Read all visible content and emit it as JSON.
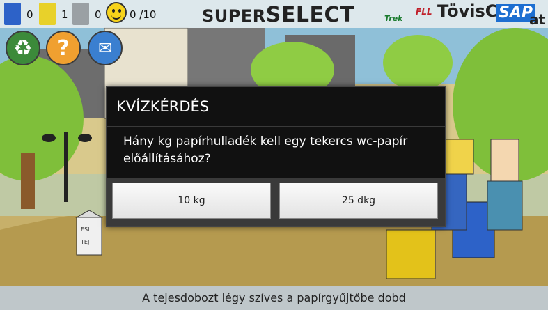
{
  "hud": {
    "bins": [
      {
        "color": "#2d62c8",
        "count": "0"
      },
      {
        "color": "#e8d12a",
        "count": "1"
      },
      {
        "color": "#9aa0a4",
        "count": "0"
      }
    ],
    "score": "0 /10",
    "brand": {
      "first": "SUPER",
      "second": "SELECT"
    },
    "sponsors": [
      "Trek",
      "FLL",
      "TövisC",
      "SAP",
      "at"
    ]
  },
  "side_buttons": [
    {
      "icon": "recycle-icon",
      "glyph": "♻",
      "color": "#3c8a3a"
    },
    {
      "icon": "question-icon",
      "glyph": "?",
      "color": "#f0a030"
    },
    {
      "icon": "mail-icon",
      "glyph": "✉",
      "color": "#3a7fd0"
    }
  ],
  "milk_carton": {
    "line1": "ESL",
    "line2": "TEJ"
  },
  "dialog": {
    "title": "KVÍZKÉRDÉS",
    "question": "Hány kg papírhulladék kell egy tekercs wc-papír előállításához?",
    "answers": [
      "10 kg",
      "25 dkg"
    ]
  },
  "status_message": "A tejesdobozt légy szíves a papírgyűjtőbe dobd"
}
